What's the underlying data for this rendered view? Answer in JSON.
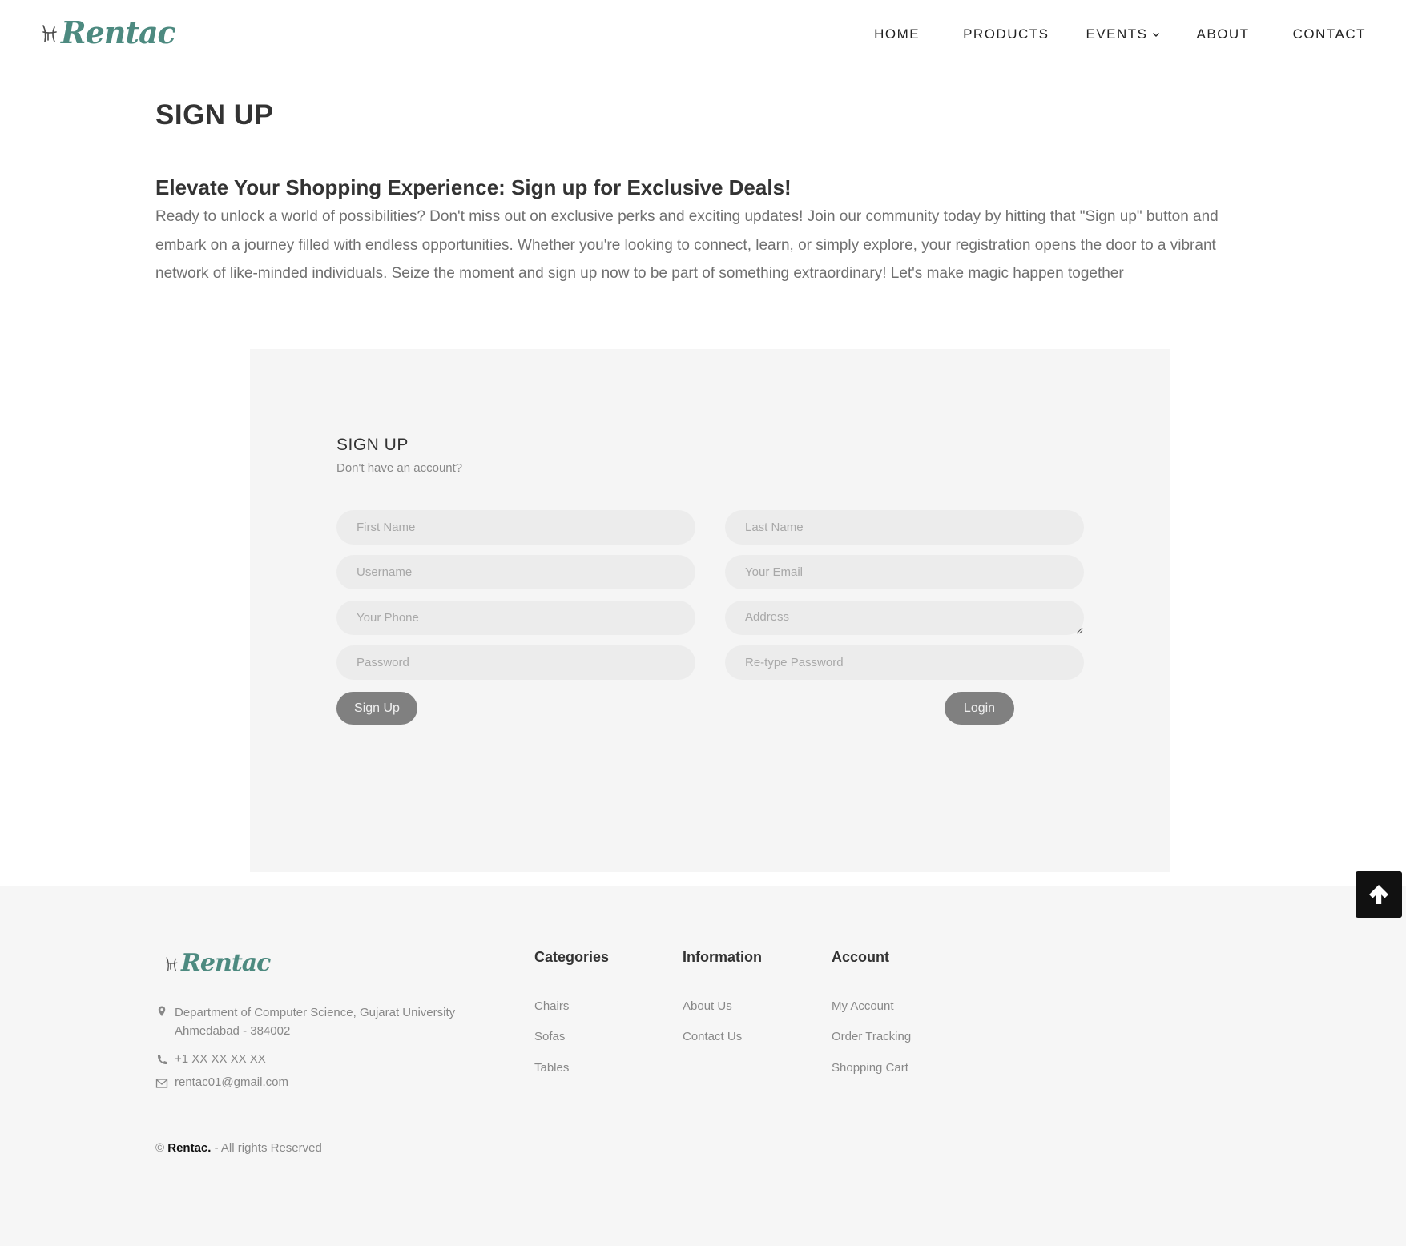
{
  "header": {
    "logo": "Rentac",
    "nav": [
      {
        "label": "HOME"
      },
      {
        "label": "PRODUCTS"
      },
      {
        "label": "EVENTS"
      },
      {
        "label": "ABOUT"
      },
      {
        "label": "CONTACT"
      }
    ]
  },
  "intro": {
    "page_title": "SIGN UP",
    "subtitle": "Elevate Your Shopping Experience: Sign up for Exclusive Deals!",
    "text": "Ready to unlock a world of possibilities? Don't miss out on exclusive perks and exciting updates! Join our community today by hitting that \"Sign up\" button and embark on a journey filled with endless opportunities. Whether you're looking to connect, learn, or simply explore, your registration opens the door to a vibrant network of like-minded individuals. Seize the moment and sign up now to be part of something extraordinary! Let's make magic happen together"
  },
  "form": {
    "title": "SIGN UP",
    "subtitle": "Don't have an account?",
    "placeholders": {
      "first_name": "First Name",
      "last_name": "Last Name",
      "username": "Username",
      "email": "Your Email",
      "phone": "Your Phone",
      "address": "Address",
      "password": "Password",
      "retype_password": "Re-type Password"
    },
    "signup_button": "Sign Up",
    "login_button": "Login"
  },
  "footer": {
    "logo": "Rentac",
    "address_line1": "Department of Computer Science, Gujarat University",
    "address_line2": "Ahmedabad - 384002",
    "phone": "+1 XX XX XX XX",
    "email": "rentac01@gmail.com",
    "categories": {
      "title": "Categories",
      "links": [
        "Chairs",
        "Sofas",
        "Tables"
      ]
    },
    "information": {
      "title": "Information",
      "links": [
        "About Us",
        "Contact Us"
      ]
    },
    "account": {
      "title": "Account",
      "links": [
        "My Account",
        "Order Tracking",
        "Shopping Cart"
      ]
    },
    "copyright_symbol": "©",
    "copyright_brand": "Rentac.",
    "copyright_rest": "- All rights Reserved"
  },
  "colors": {
    "brand": "#4d8a80",
    "panel_bg": "#f5f5f5",
    "button_bg": "#808080",
    "back_to_top_bg": "#111111"
  },
  "icons": {
    "back_to_top": "arrow-up-icon",
    "address": "map-pin-icon",
    "phone": "phone-icon",
    "email": "mail-icon",
    "dropdown": "chevron-down-icon"
  }
}
